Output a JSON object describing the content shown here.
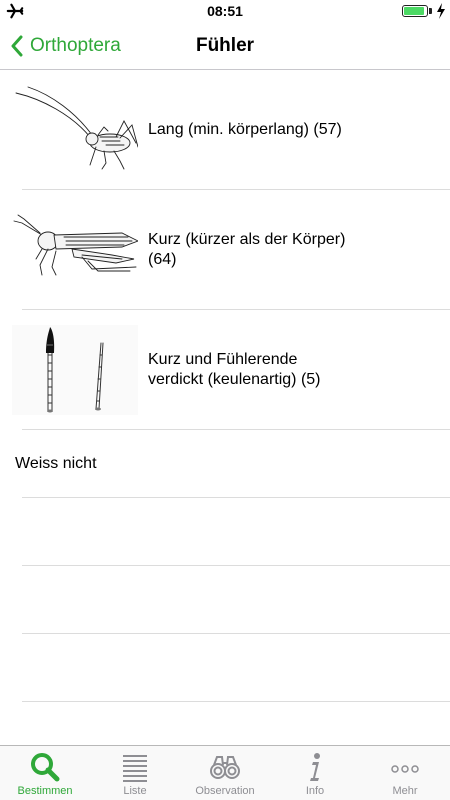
{
  "status": {
    "time": "08:51",
    "battery_level": 0.9,
    "accent": "#4cd964"
  },
  "nav": {
    "back_label": "Orthoptera",
    "title": "Fühler"
  },
  "options": [
    {
      "icon": "long-antenna-cricket-illustration",
      "label": "Lang (min. körperlang) (57)"
    },
    {
      "icon": "short-antenna-grasshopper-illustration",
      "label": "Kurz (kürzer als der Körper) (64)"
    },
    {
      "icon": "clubbed-antenna-illustration",
      "label": "Kurz und Fühlerende verdickt (keulenartig) (5)"
    },
    {
      "label": "Weiss nicht"
    }
  ],
  "tabs": [
    {
      "icon": "search-icon",
      "label": "Bestimmen",
      "active": true
    },
    {
      "icon": "list-icon",
      "label": "Liste"
    },
    {
      "icon": "binoculars-icon",
      "label": "Observation"
    },
    {
      "icon": "info-icon",
      "label": "Info"
    },
    {
      "icon": "more-icon",
      "label": "Mehr"
    }
  ],
  "colors": {
    "accent": "#2fa839",
    "inactive": "#8e8e93"
  }
}
